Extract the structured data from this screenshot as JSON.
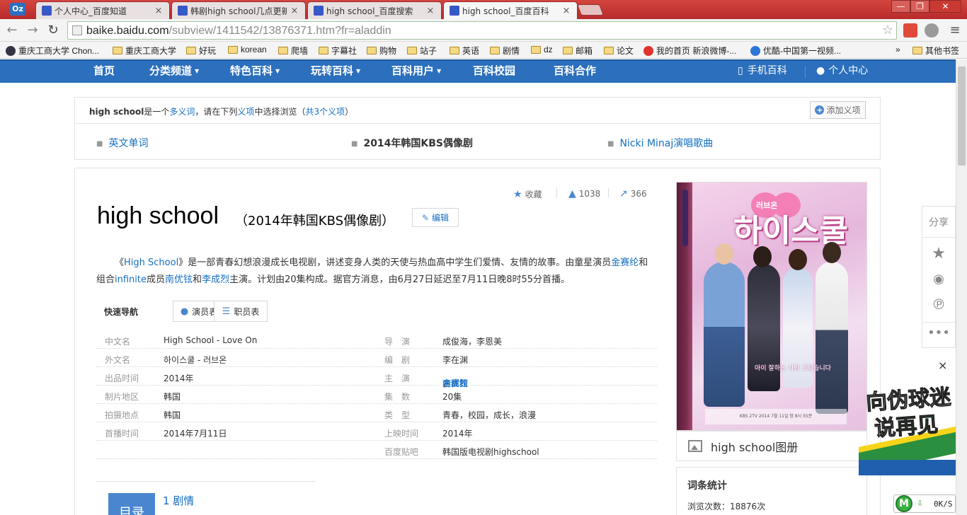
{
  "browser": {
    "app_icon": "Oz",
    "tabs": [
      {
        "title": "个人中心_百度知道",
        "close": "×"
      },
      {
        "title": "韩剧high school几点更新",
        "close": "×"
      },
      {
        "title": "high school_百度搜索",
        "close": "×"
      },
      {
        "title": "high school_百度百科",
        "close": "×"
      }
    ],
    "tab_icon": "🐾",
    "window_controls": {
      "minimize": "—",
      "maximize": "❐",
      "close": "✕"
    },
    "nav": {
      "back": "←",
      "forward": "→",
      "reload": "↻"
    },
    "url_host": "baike.baidu.com",
    "url_path": "/subview/1411542/13876371.htm?fr=aladdin",
    "star": "☆",
    "menu": "≡",
    "bookmarks": [
      {
        "label": "重庆工商大学 Chon...",
        "icon": "globe"
      },
      {
        "label": "重庆工商大学",
        "icon": "folder"
      },
      {
        "label": "好玩",
        "icon": "folder"
      },
      {
        "label": "korean",
        "icon": "folder"
      },
      {
        "label": "爬墙",
        "icon": "folder"
      },
      {
        "label": "字幕社",
        "icon": "folder"
      },
      {
        "label": "购物",
        "icon": "folder"
      },
      {
        "label": "站子",
        "icon": "folder"
      },
      {
        "label": "英语",
        "icon": "folder"
      },
      {
        "label": "剧情",
        "icon": "folder"
      },
      {
        "label": "dz",
        "icon": "folder"
      },
      {
        "label": "邮箱",
        "icon": "folder"
      },
      {
        "label": "论文",
        "icon": "folder"
      },
      {
        "label": "我的首页 新浪微博-...",
        "icon": "weibo"
      },
      {
        "label": "优酷-中国第一视频...",
        "icon": "youku"
      }
    ],
    "bookmarks_more": "»",
    "other_bookmarks": "其他书签"
  },
  "sitenav": {
    "items": [
      {
        "label": "首页",
        "dropdown": false
      },
      {
        "label": "分类频道",
        "dropdown": true
      },
      {
        "label": "特色百科",
        "dropdown": true
      },
      {
        "label": "玩转百科",
        "dropdown": true
      },
      {
        "label": "百科用户",
        "dropdown": true
      },
      {
        "label": "百科校园",
        "dropdown": false
      },
      {
        "label": "百科合作",
        "dropdown": false
      }
    ],
    "arrow": "▼",
    "mobile": "手机百科",
    "personal": "个人中心"
  },
  "disambig": {
    "term": "high school",
    "text_a": "是一个",
    "link_a": "多义词",
    "text_b": "，请在下列",
    "link_b": "义项",
    "text_c": "中选择浏览（",
    "link_c": "共3个义项",
    "text_d": "）",
    "add_label": "添加义项",
    "senses": [
      {
        "label": "英文单词",
        "current": false
      },
      {
        "label": "2014年韩国KBS偶像剧",
        "current": true
      },
      {
        "label": "Nicki Minaj演唱歌曲",
        "current": false
      }
    ]
  },
  "article": {
    "collect": "收藏",
    "likes": "1038",
    "shares": "366",
    "title": "high school",
    "subtitle": "（2014年韩国KBS偶像剧）",
    "edit": "编辑",
    "summary": {
      "p1": "《",
      "l1": "High School",
      "p2": "》是一部青春幻想浪漫成长电视剧，讲述变身人类的天使与热血高中学生们爱情、友情的故事。由童星演员",
      "l2": "金赛纶",
      "p3": "和组合",
      "l3": "infinite",
      "p4": "成员",
      "l4": "南优铉",
      "p5": "和",
      "l5": "李成烈",
      "p6": "主演。计划由20集构成。据官方消息，由6月27日延迟至7月11日晚8时55分首播。"
    },
    "quicknav_label": "快速导航",
    "quicknav": [
      "演员表",
      "职员表"
    ],
    "info": [
      {
        "k1": "中文名",
        "v1": "High School - Love On",
        "k2": "导　演",
        "v2": "成俊海，李恩美"
      },
      {
        "k1": "外文名",
        "v1": "하이스쿨 - 러브온",
        "k2": "编　剧",
        "v2": "李在渊"
      },
      {
        "k1": "出品时间",
        "v1": "2014年",
        "k2": "主　演",
        "v2": ""
      },
      {
        "k1": "制片地区",
        "v1": "韩国",
        "k2": "集　数",
        "v2": "20集"
      },
      {
        "k1": "拍摄地点",
        "v1": "韩国",
        "k2": "类　型",
        "v2": "青春，校园，成长，浪漫"
      },
      {
        "k1": "首播时间",
        "v1": "2014年7月11日",
        "k2": "上映时间",
        "v2": "2014年"
      },
      {
        "k1": "",
        "v1": "",
        "k2": "百度贴吧",
        "v2": "韩国版电视剧highschool"
      }
    ],
    "stars": {
      "a": "南优铉",
      "b": "金赛纶",
      "c": "李成烈",
      "sep": "，"
    },
    "toc_label": "目录",
    "toc_first": "1  剧情"
  },
  "sidebar": {
    "poster_title": "하이스쿨",
    "poster_sub": "러브온",
    "poster_caption": "아이 잘하는 사람 고맙습니다",
    "poster_credits": "KBS 2TV 2014 7월 11일 밤 8시 55분",
    "album": "high school图册",
    "stats_title": "词条统计",
    "views_label": "浏览次数：",
    "views": "18876次"
  },
  "share": {
    "label": "分享"
  },
  "ad": {
    "line1": "向伪球迷",
    "line2_a": "说",
    "line2_b": "再见",
    "close": "×"
  },
  "net": {
    "speed": "0K/S",
    "m": "M"
  }
}
